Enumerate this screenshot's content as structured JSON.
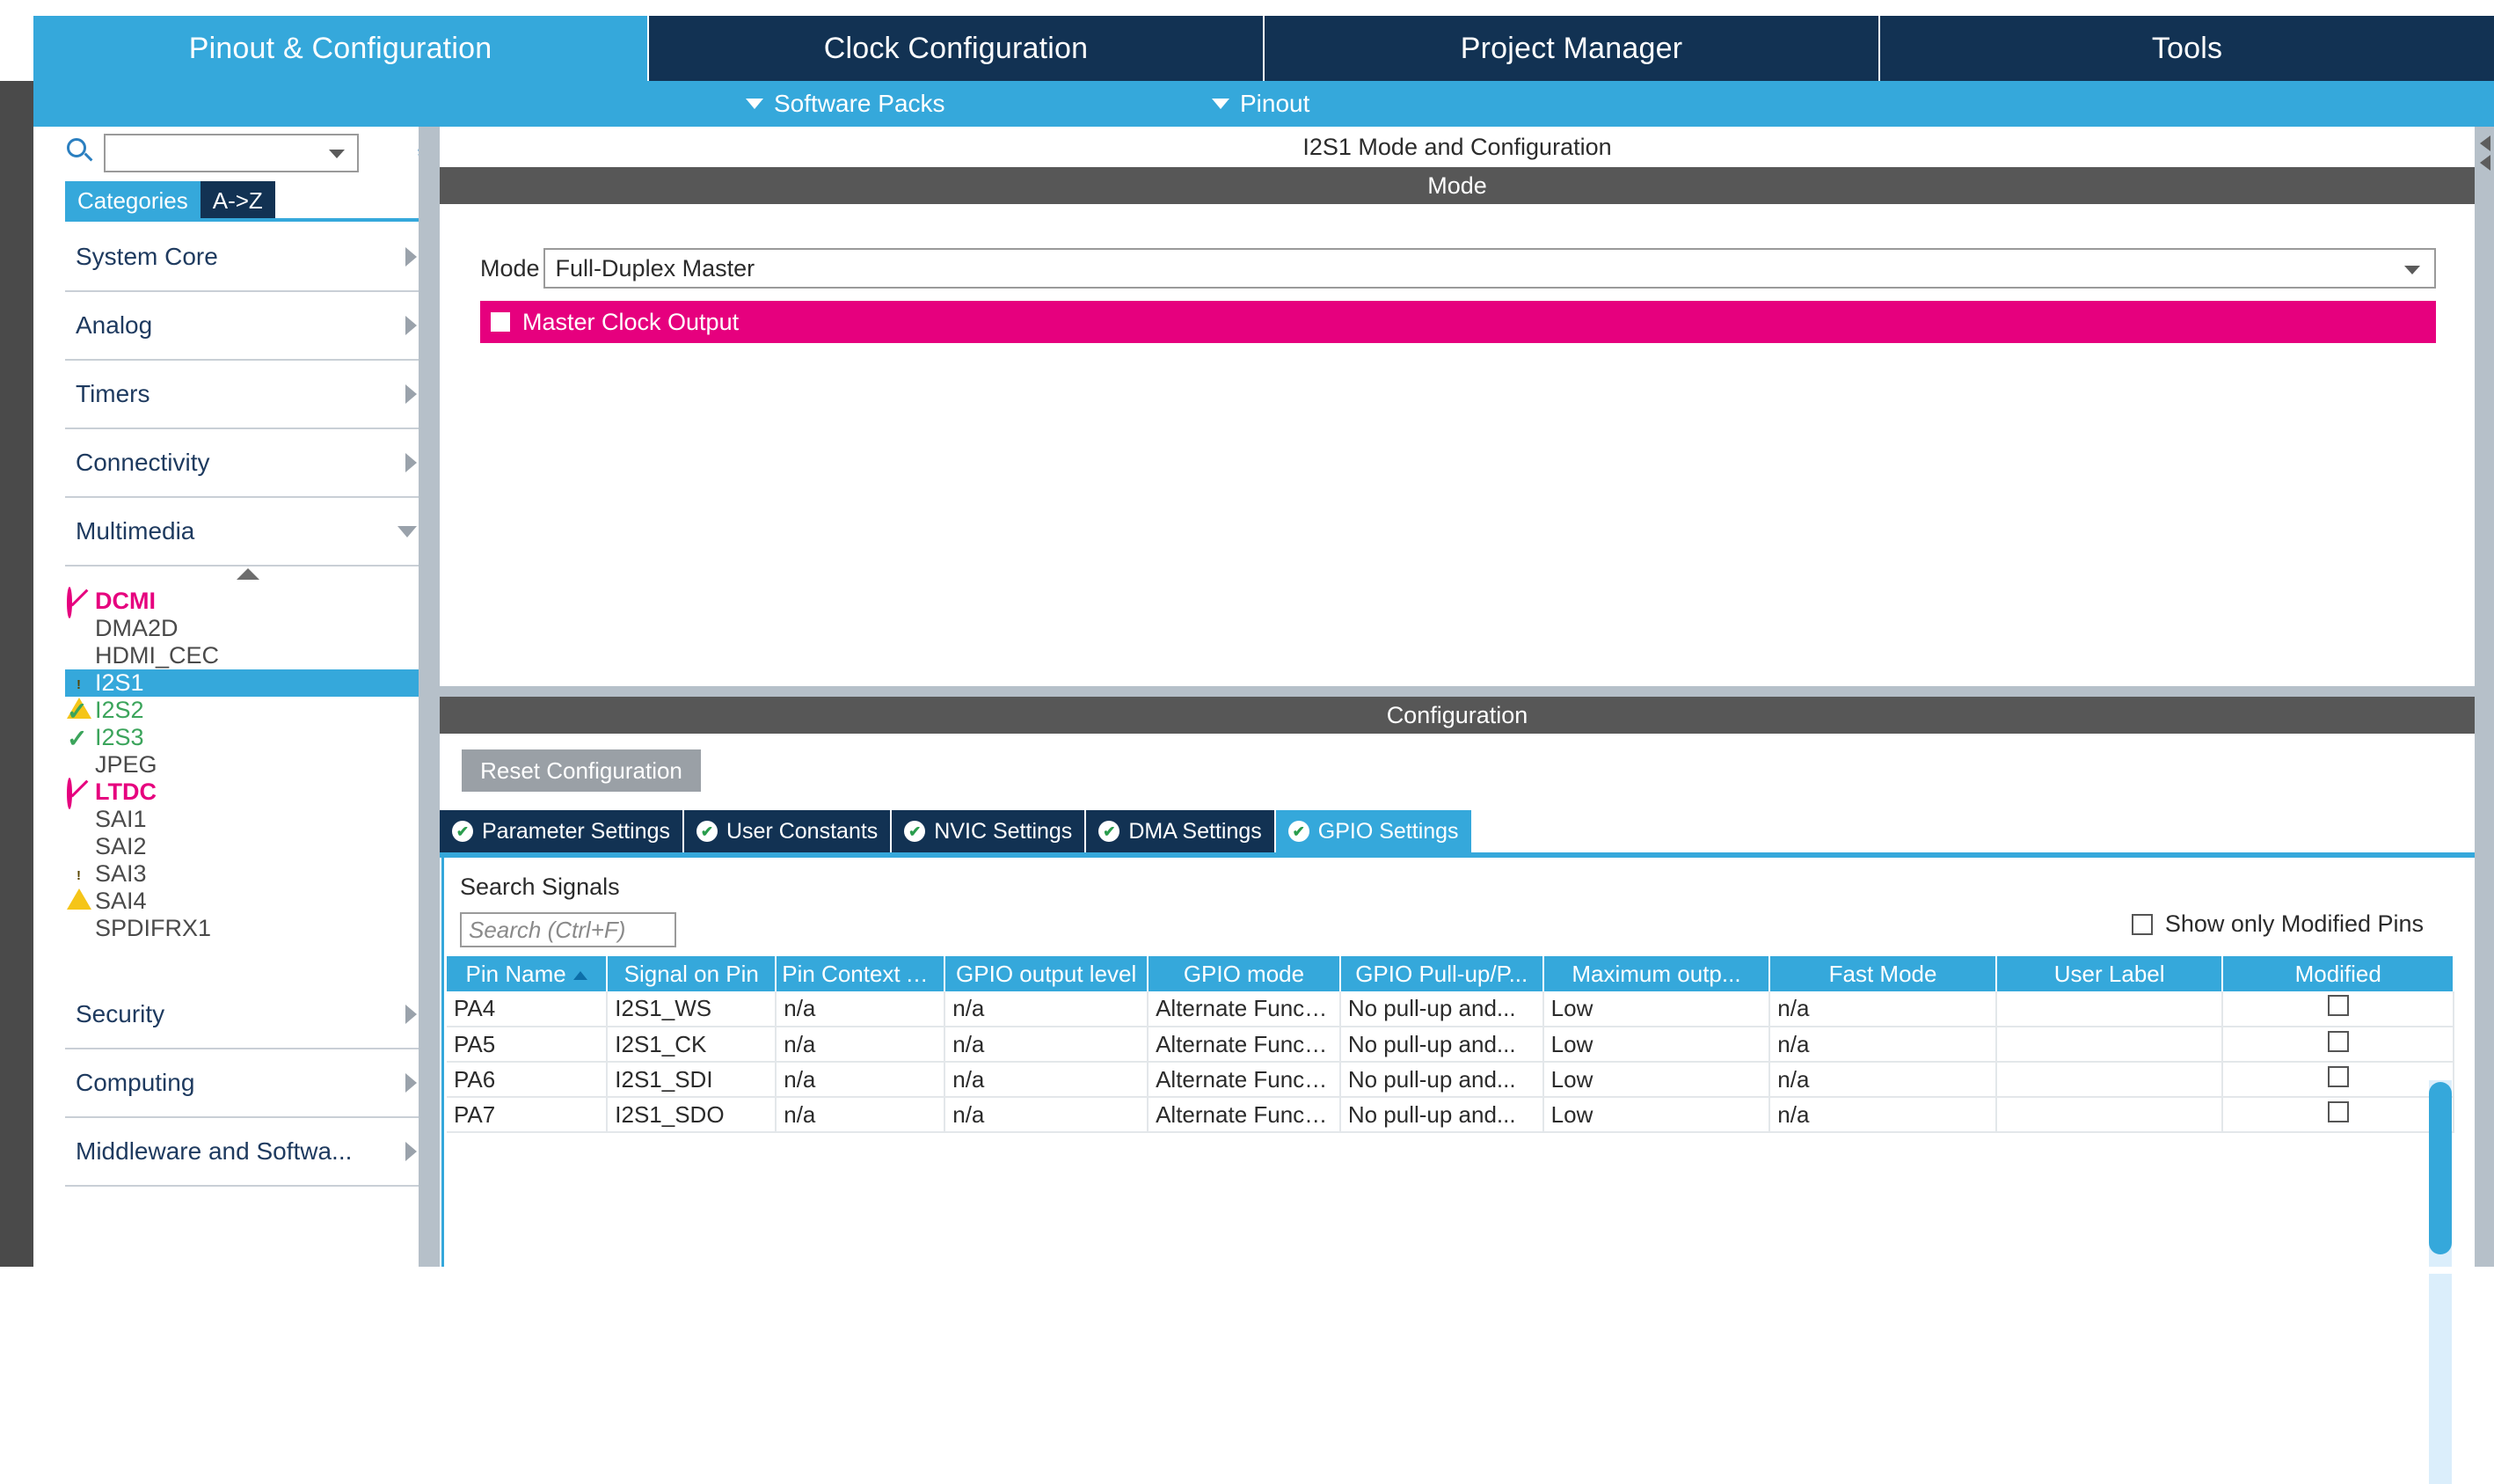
{
  "nav": {
    "tabs": [
      {
        "label": "Pinout & Configuration",
        "active": true
      },
      {
        "label": "Clock Configuration",
        "active": false
      },
      {
        "label": "Project Manager",
        "active": false
      },
      {
        "label": "Tools",
        "active": false
      }
    ]
  },
  "subbar": {
    "software_packs": "Software Packs",
    "pinout": "Pinout"
  },
  "sidebar": {
    "search_value": "",
    "search_icon": "search-icon",
    "gear_icon": "gear-icon",
    "tabs": [
      {
        "label": "Categories",
        "selected": true
      },
      {
        "label": "A->Z",
        "selected": false
      }
    ],
    "categories": [
      {
        "label": "System Core",
        "state": "collapsed"
      },
      {
        "label": "Analog",
        "state": "collapsed"
      },
      {
        "label": "Timers",
        "state": "collapsed"
      },
      {
        "label": "Connectivity",
        "state": "collapsed"
      },
      {
        "label": "Multimedia",
        "state": "expanded"
      }
    ],
    "peripherals": [
      {
        "label": "DCMI",
        "status": "forbidden",
        "selected": false
      },
      {
        "label": "DMA2D",
        "status": "none",
        "selected": false
      },
      {
        "label": "HDMI_CEC",
        "status": "none",
        "selected": false
      },
      {
        "label": "I2S1",
        "status": "warning",
        "selected": true
      },
      {
        "label": "I2S2",
        "status": "ok",
        "selected": false
      },
      {
        "label": "I2S3",
        "status": "ok",
        "selected": false
      },
      {
        "label": "JPEG",
        "status": "none",
        "selected": false
      },
      {
        "label": "LTDC",
        "status": "forbidden",
        "selected": false
      },
      {
        "label": "SAI1",
        "status": "none",
        "selected": false
      },
      {
        "label": "SAI2",
        "status": "none",
        "selected": false
      },
      {
        "label": "SAI3",
        "status": "warning",
        "selected": false
      },
      {
        "label": "SAI4",
        "status": "none",
        "selected": false
      },
      {
        "label": "SPDIFRX1",
        "status": "none",
        "selected": false
      }
    ],
    "categories_bottom": [
      {
        "label": "Security",
        "state": "collapsed"
      },
      {
        "label": "Computing",
        "state": "collapsed"
      },
      {
        "label": "Middleware and Softwa...",
        "state": "collapsed"
      }
    ]
  },
  "panel": {
    "title": "I2S1 Mode and Configuration",
    "mode_band": "Mode",
    "mode_label": "Mode",
    "mode_value": "Full-Duplex Master",
    "master_clock_output": {
      "label": "Master Clock Output",
      "checked": false,
      "highlight_color": "#e6007e"
    },
    "config_band": "Configuration",
    "reset_button": "Reset Configuration",
    "config_tabs": [
      {
        "label": "Parameter Settings",
        "active": false
      },
      {
        "label": "User Constants",
        "active": false
      },
      {
        "label": "NVIC Settings",
        "active": false
      },
      {
        "label": "DMA Settings",
        "active": false
      },
      {
        "label": "GPIO Settings",
        "active": true
      }
    ],
    "search_signals_label": "Search Signals",
    "search_signals_placeholder": "Search (Ctrl+F)",
    "show_only_modified": {
      "label": "Show only Modified Pins",
      "checked": false
    }
  },
  "table": {
    "columns": [
      "Pin Name",
      "Signal on Pin",
      "Pin Context Ass...",
      "GPIO output level",
      "GPIO mode",
      "GPIO Pull-up/P...",
      "Maximum outp...",
      "Fast Mode",
      "User Label",
      "Modified"
    ],
    "sorted_column": "Pin Name",
    "rows": [
      {
        "pin_name": "PA4",
        "signal_on_pin": "I2S1_WS",
        "pin_context": "n/a",
        "output_level": "n/a",
        "gpio_mode": "Alternate Functi...",
        "pull": "No pull-up and...",
        "max_output": "Low",
        "fast_mode": "n/a",
        "user_label": "",
        "modified": false
      },
      {
        "pin_name": "PA5",
        "signal_on_pin": "I2S1_CK",
        "pin_context": "n/a",
        "output_level": "n/a",
        "gpio_mode": "Alternate Functi...",
        "pull": "No pull-up and...",
        "max_output": "Low",
        "fast_mode": "n/a",
        "user_label": "",
        "modified": false
      },
      {
        "pin_name": "PA6",
        "signal_on_pin": "I2S1_SDI",
        "pin_context": "n/a",
        "output_level": "n/a",
        "gpio_mode": "Alternate Functi...",
        "pull": "No pull-up and...",
        "max_output": "Low",
        "fast_mode": "n/a",
        "user_label": "",
        "modified": false
      },
      {
        "pin_name": "PA7",
        "signal_on_pin": "I2S1_SDO",
        "pin_context": "n/a",
        "output_level": "n/a",
        "gpio_mode": "Alternate Functi...",
        "pull": "No pull-up and...",
        "max_output": "Low",
        "fast_mode": "n/a",
        "user_label": "",
        "modified": false
      }
    ]
  },
  "colors": {
    "accent_blue": "#35a8db",
    "dark_navy": "#123253",
    "band_gray": "#575757",
    "pink": "#e6007e",
    "green": "#3ba45b",
    "warning_yellow": "#f5c518"
  }
}
